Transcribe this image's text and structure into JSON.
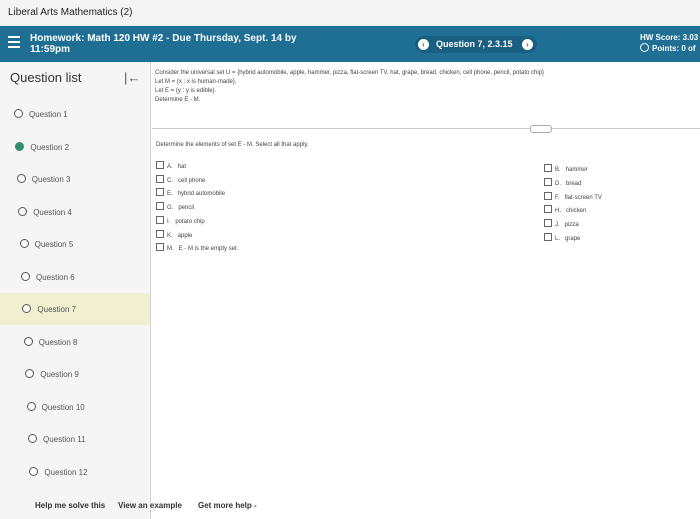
{
  "window": {
    "title": "Liberal Arts Mathematics (2)"
  },
  "header": {
    "homework_title_line1": "Homework: Math 120 HW #2 - Due Thursday, Sept. 14 by",
    "homework_title_line2": "11:59pm",
    "question_nav": "Question 7, 2.3.15",
    "prev_icon": "chevron-left-icon",
    "next_icon": "chevron-right-icon",
    "score": "HW Score: 3.03",
    "points": "Points: 0 of"
  },
  "sidebar": {
    "title": "Question list",
    "collapse_icon": "collapse-left-icon",
    "questions": [
      {
        "label": "Question 1",
        "status": "open"
      },
      {
        "label": "Question 2",
        "status": "done"
      },
      {
        "label": "Question 3",
        "status": "open"
      },
      {
        "label": "Question 4",
        "status": "open"
      },
      {
        "label": "Question 5",
        "status": "open"
      },
      {
        "label": "Question 6",
        "status": "open"
      },
      {
        "label": "Question 7",
        "status": "current"
      },
      {
        "label": "Question 8",
        "status": "open"
      },
      {
        "label": "Question 9",
        "status": "open"
      },
      {
        "label": "Question 10",
        "status": "open"
      },
      {
        "label": "Question 11",
        "status": "open"
      },
      {
        "label": "Question 12",
        "status": "open"
      }
    ]
  },
  "problem": {
    "universe": "Consider the universal set U = {hybrid automobile, apple, hammer, pizza, flat-screen TV, hat, grape, bread, chicken, cell phone, pencil, potato chip}",
    "set_m": "Let M = {x : x is human-made}.",
    "set_e": "Let E = {y : y is edible}.",
    "task": "Determine E - M.",
    "instruction": "Determine the elements of set E - M. Select all that apply.",
    "choices_left": [
      {
        "letter": "A.",
        "text": "hat"
      },
      {
        "letter": "C.",
        "text": "cell phone"
      },
      {
        "letter": "E.",
        "text": "hybrid automobile"
      },
      {
        "letter": "G.",
        "text": "pencil"
      },
      {
        "letter": "I.",
        "text": "potato chip"
      },
      {
        "letter": "K.",
        "text": "apple"
      },
      {
        "letter": "M.",
        "text": "E - M is the empty set."
      }
    ],
    "choices_right": [
      {
        "letter": "B.",
        "text": "hammer"
      },
      {
        "letter": "D.",
        "text": "bread"
      },
      {
        "letter": "F.",
        "text": "flat-screen TV"
      },
      {
        "letter": "H.",
        "text": "chicken"
      },
      {
        "letter": "J.",
        "text": "pizza"
      },
      {
        "letter": "L.",
        "text": "grape"
      }
    ]
  },
  "footer": {
    "help_solve": "Help me solve this",
    "view_example": "View an example",
    "more_help": "Get more help -"
  },
  "colors": {
    "header_bg": "#1f6f94",
    "done": "#2f8f6f",
    "current_bg": "#f0f0d0"
  }
}
